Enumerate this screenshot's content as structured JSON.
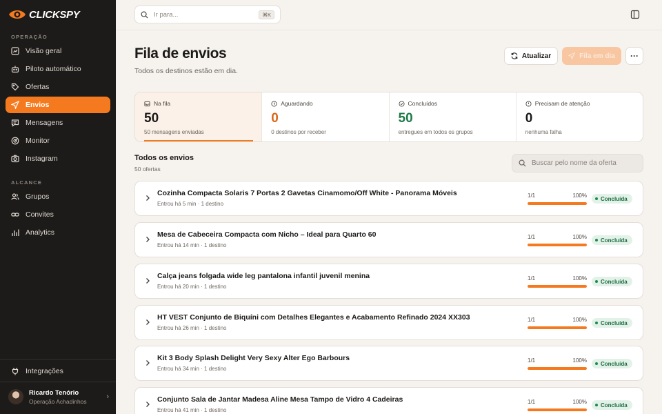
{
  "brand": {
    "name": "CLICKSPY",
    "accent": "#f57a1f"
  },
  "sidebar": {
    "section_operacao": "OPERAÇÃO",
    "section_alcance": "ALCANCE",
    "items": [
      {
        "label": "Visão geral",
        "icon": "chart-icon"
      },
      {
        "label": "Piloto automático",
        "icon": "robot-icon"
      },
      {
        "label": "Ofertas",
        "icon": "tag-icon"
      },
      {
        "label": "Envios",
        "icon": "send-icon",
        "active": true
      },
      {
        "label": "Mensagens",
        "icon": "message-icon"
      },
      {
        "label": "Monitor",
        "icon": "radar-icon"
      },
      {
        "label": "Instagram",
        "icon": "camera-icon"
      },
      {
        "label": "Grupos",
        "icon": "users-icon"
      },
      {
        "label": "Convites",
        "icon": "link-icon"
      },
      {
        "label": "Analytics",
        "icon": "bars-icon"
      }
    ],
    "integrations": "Integrações",
    "user": {
      "name": "Ricardo Tenório",
      "org": "Operação Achadinhos"
    }
  },
  "topbar": {
    "search_placeholder": "Ir para...",
    "shortcut": "⌘K"
  },
  "page": {
    "title": "Fila de envios",
    "subtitle": "Todos os destinos estão em dia.",
    "refresh_label": "Atualizar",
    "queue_label": "Fila em dia"
  },
  "stats": [
    {
      "label": "Na fila",
      "value": "50",
      "caption": "50 mensagens enviadas",
      "color": "#1c1a18",
      "icon": "inbox-icon"
    },
    {
      "label": "Aguardando",
      "value": "0",
      "caption": "0 destinos por receber",
      "color": "#d9681a",
      "icon": "clock-icon"
    },
    {
      "label": "Concluídos",
      "value": "50",
      "caption": "entregues em todos os grupos",
      "color": "#1d7a47",
      "icon": "check-circle-icon"
    },
    {
      "label": "Precisam de atenção",
      "value": "0",
      "caption": "nenhuma falha",
      "color": "#1c1a18",
      "icon": "alert-icon"
    }
  ],
  "list": {
    "title": "Todos os envios",
    "subtitle": "50 ofertas",
    "search_placeholder": "Buscar pelo nome da oferta",
    "rows": [
      {
        "title": "Cozinha Compacta Solaris 7 Portas 2 Gavetas Cinamomo/Off White - Panorama Móveis",
        "meta": "Entrou há 5 min · 1 destino",
        "fraction": "1/1",
        "percent": "100%",
        "progress": 1.0,
        "status": "Concluída"
      },
      {
        "title": "Mesa de Cabeceira Compacta com Nicho – Ideal para Quarto 60",
        "meta": "Entrou há 14 min · 1 destino",
        "fraction": "1/1",
        "percent": "100%",
        "progress": 1.0,
        "status": "Concluída"
      },
      {
        "title": "Calça jeans folgada wide leg pantalona infantil juvenil menina",
        "meta": "Entrou há 20 min · 1 destino",
        "fraction": "1/1",
        "percent": "100%",
        "progress": 1.0,
        "status": "Concluída"
      },
      {
        "title": "HT VEST Conjunto de Biquíni com Detalhes Elegantes e Acabamento Refinado 2024 XX303",
        "meta": "Entrou há 26 min · 1 destino",
        "fraction": "1/1",
        "percent": "100%",
        "progress": 1.0,
        "status": "Concluída"
      },
      {
        "title": "Kit 3 Body Splash Delight Very Sexy Alter Ego Barbours",
        "meta": "Entrou há 34 min · 1 destino",
        "fraction": "1/1",
        "percent": "100%",
        "progress": 1.0,
        "status": "Concluída"
      },
      {
        "title": "Conjunto Sala de Jantar Madesa Aline Mesa Tampo de Vidro 4 Cadeiras",
        "meta": "Entrou há 41 min · 1 destino",
        "fraction": "1/1",
        "percent": "100%",
        "progress": 1.0,
        "status": "Concluída"
      }
    ]
  }
}
